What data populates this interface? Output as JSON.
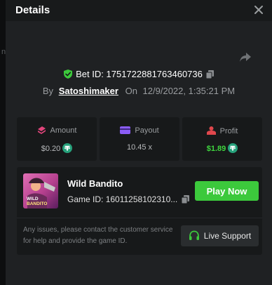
{
  "background": {
    "partial_char": "n"
  },
  "header": {
    "title": "Details"
  },
  "bet": {
    "label": "Bet ID:",
    "id": "1751722881763460736"
  },
  "meta": {
    "by_label": "By",
    "username": "Satoshimaker",
    "on_label": "On",
    "date": "12/9/2022, 1:35:21 PM"
  },
  "stats": {
    "amount": {
      "label": "Amount",
      "value": "$0.20"
    },
    "payout": {
      "label": "Payout",
      "value": "10.45 x"
    },
    "profit": {
      "label": "Profit",
      "value": "$1.89"
    }
  },
  "game": {
    "name": "Wild Bandito",
    "id_label": "Game ID:",
    "id": "16011258102310...",
    "thumb_text_line1": "WILD",
    "thumb_text_line2": "BANDITO",
    "play_label": "Play Now"
  },
  "support": {
    "help_text": "Any issues, please contact the customer service for help and provide the game ID.",
    "button_label": "Live Support"
  },
  "colors": {
    "accent_green": "#3cc93c",
    "profit_green": "#3fd63f",
    "amount_icon": "#e0457b",
    "payout_icon": "#8a5cf5",
    "profit_icon": "#e0474c",
    "tether": "#26a17b"
  },
  "icons": [
    "close-icon",
    "share-icon",
    "shield-check-icon",
    "copy-icon",
    "amount-icon",
    "payout-icon",
    "profit-icon",
    "tether-icon",
    "headset-icon"
  ]
}
